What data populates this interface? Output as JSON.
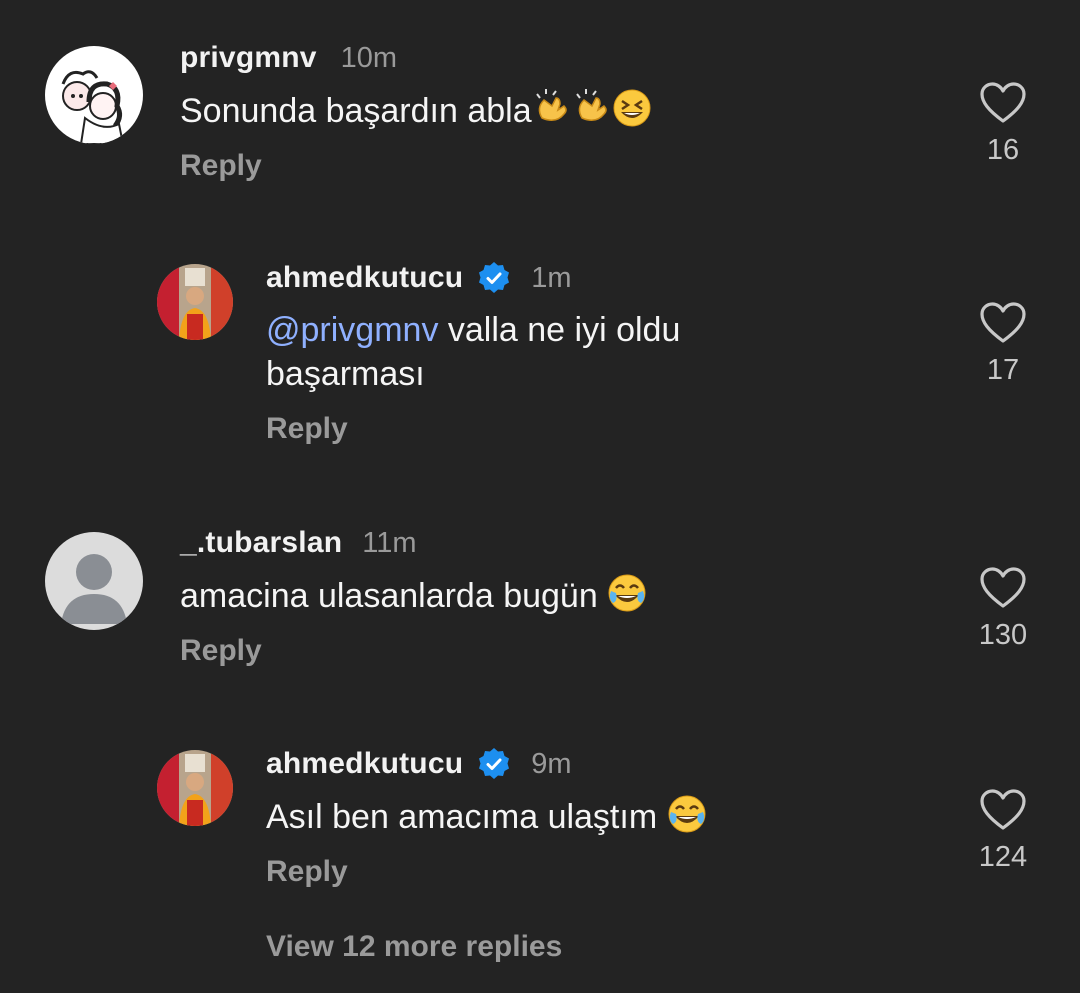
{
  "comments": [
    {
      "username": "privgmnv",
      "time": "10m",
      "text": "Sonunda başardın abla",
      "emojis": [
        "clapping-hands",
        "clapping-hands",
        "grinning-squinting-face"
      ],
      "reply_label": "Reply",
      "likes": "16",
      "verified": false
    },
    {
      "username": "ahmedkutucu",
      "time": "1m",
      "mention": "@privgmnv",
      "text": " valla ne iyi oldu başarması",
      "reply_label": "Reply",
      "likes": "17",
      "verified": true
    },
    {
      "username": "_.tubarslan",
      "time": "11m",
      "text": "amacina ulasanlarda bugün ",
      "emojis": [
        "face-with-tears-of-joy"
      ],
      "reply_label": "Reply",
      "likes": "130",
      "verified": false
    },
    {
      "username": "ahmedkutucu",
      "time": "9m",
      "text": "Asıl ben amacıma ulaştım ",
      "emojis": [
        "face-with-tears-of-joy"
      ],
      "reply_label": "Reply",
      "likes": "124",
      "verified": true
    }
  ],
  "view_more_label": "View 12 more replies",
  "colors": {
    "background": "#232323",
    "mention": "#8fb0ff",
    "verified_badge": "#1d8ff0",
    "secondary_text": "#9a9a9a"
  }
}
